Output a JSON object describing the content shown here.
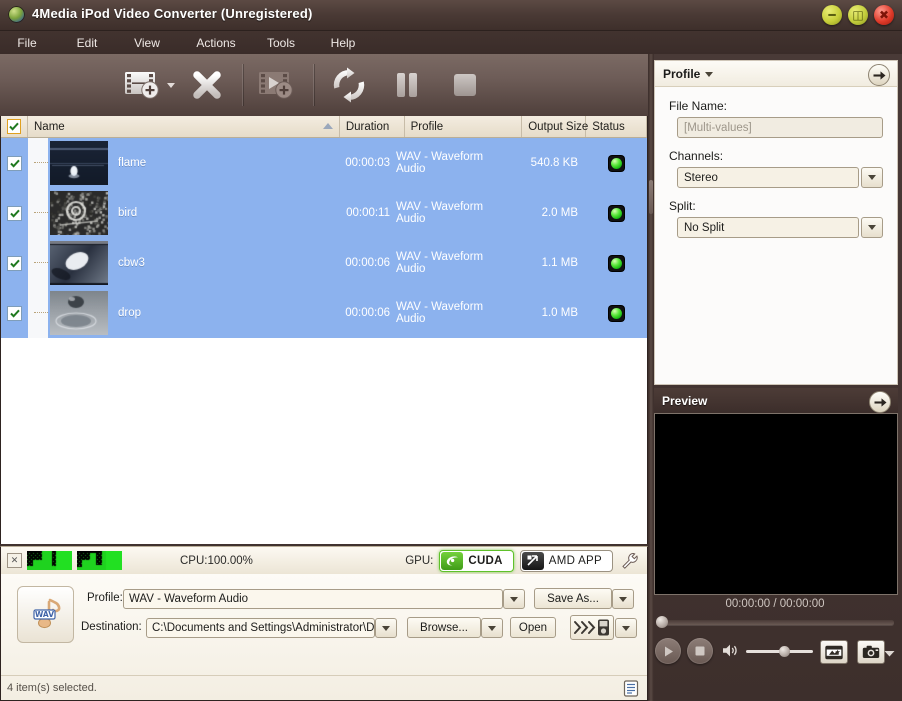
{
  "window": {
    "title": "4Media iPod Video Converter (Unregistered)",
    "app_icon": "globe-icon",
    "minimize": "–",
    "maximize": "▣",
    "close": "✕"
  },
  "menu": {
    "items": [
      {
        "label": "File"
      },
      {
        "label": "Edit"
      },
      {
        "label": "View"
      },
      {
        "label": "Actions"
      },
      {
        "label": "Tools"
      },
      {
        "label": "Help"
      }
    ]
  },
  "toolbar": {
    "buttons": [
      {
        "name": "add-file-button",
        "icon": "film-add-icon",
        "has_caret": true,
        "enabled": true
      },
      {
        "name": "remove-file-button",
        "icon": "close-x-icon",
        "has_caret": false,
        "enabled": true
      },
      {
        "name": "add-clip-button",
        "icon": "film-clip-add-icon",
        "has_caret": false,
        "enabled": false
      },
      {
        "name": "convert-button",
        "icon": "convert-refresh-icon",
        "has_caret": false,
        "enabled": true
      },
      {
        "name": "pause-button",
        "icon": "pause-icon",
        "has_caret": false,
        "enabled": true
      },
      {
        "name": "stop-button",
        "icon": "stop-icon",
        "has_caret": false,
        "enabled": true
      }
    ]
  },
  "file_list": {
    "select_all_checked": true,
    "sort_column": "Name",
    "sort_direction": "ascending",
    "columns": [
      {
        "key": "check",
        "label": ""
      },
      {
        "key": "name",
        "label": "Name"
      },
      {
        "key": "duration",
        "label": "Duration"
      },
      {
        "key": "profile",
        "label": "Profile"
      },
      {
        "key": "size",
        "label": "Output Size"
      },
      {
        "key": "status",
        "label": "Status"
      }
    ],
    "rows": [
      {
        "checked": true,
        "name": "flame",
        "duration": "00:00:03",
        "profile": "WAV - Waveform Audio",
        "size": "540.8 KB",
        "status": "ready",
        "thumb": "flame"
      },
      {
        "checked": true,
        "name": "bird",
        "duration": "00:00:11",
        "profile": "WAV - Waveform Audio",
        "size": "2.0 MB",
        "status": "ready",
        "thumb": "bird"
      },
      {
        "checked": true,
        "name": "cbw3",
        "duration": "00:00:06",
        "profile": "WAV - Waveform Audio",
        "size": "1.1 MB",
        "status": "ready",
        "thumb": "cbw3"
      },
      {
        "checked": true,
        "name": "drop",
        "duration": "00:00:06",
        "profile": "WAV - Waveform Audio",
        "size": "1.0 MB",
        "status": "ready",
        "thumb": "drop"
      }
    ]
  },
  "cpu_bar": {
    "close_label": "✕",
    "cpu_text": "CPU:100.00%",
    "gpu_label": "GPU:",
    "cuda_label": "CUDA",
    "cuda_active": true,
    "amd_label": "AMD APP",
    "amd_active": false,
    "settings_icon": "wrench-icon"
  },
  "bottom": {
    "format_icon": "wav-note-icon",
    "profile_label": "Profile:",
    "profile_value": "WAV - Waveform Audio",
    "save_as_label": "Save As...",
    "destination_label": "Destination:",
    "destination_value": "C:\\Documents and Settings\\Administrator\\De",
    "browse_label": "Browse...",
    "open_label": "Open",
    "transfer_icon": "ipod-transfer-icon",
    "status_text": "4 item(s) selected.",
    "log_icon": "log-list-icon"
  },
  "profile_panel": {
    "title": "Profile",
    "expand_icon": "arrow-right-icon",
    "file_name_label": "File Name:",
    "file_name_value": "[Multi-values]",
    "channels_label": "Channels:",
    "channels_value": "Stereo",
    "split_label": "Split:",
    "split_value": "No Split"
  },
  "preview_panel": {
    "title": "Preview",
    "expand_icon": "arrow-right-icon",
    "time_display": "00:00:00 / 00:00:00",
    "seek_position_percent": 0,
    "volume_percent": 57,
    "play_icon": "play-icon",
    "stop_icon": "stop-icon",
    "volume_icon": "speaker-icon",
    "snapshot_folder_icon": "snapshot-folder-icon",
    "camera_icon": "camera-icon",
    "camera_caret_icon": "chevron-down-icon"
  },
  "colors": {
    "title_bar": "#4a3a35",
    "toolbar": "#6d5c57",
    "row_selected": "#8cb2ee",
    "header_beige": "#ece5d5",
    "cuda_green": "#5fc12a",
    "led_green": "#5ae83a"
  }
}
